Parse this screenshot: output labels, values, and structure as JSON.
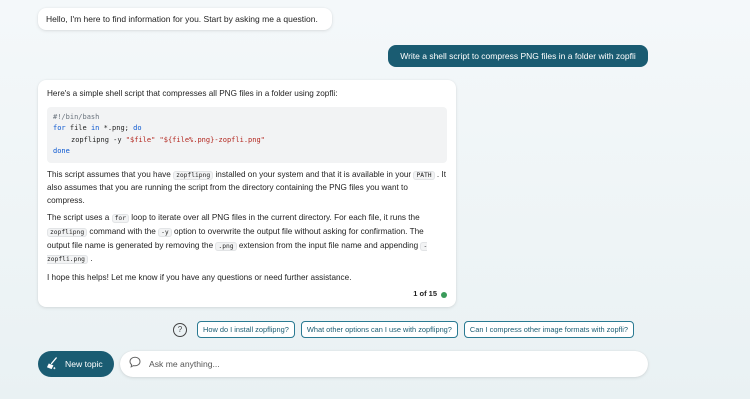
{
  "greeting": "Hello, I'm here to find information for you. Start by asking me a question.",
  "user_message": "Write a shell script to compress PNG files in a folder with zopfli",
  "answer": {
    "intro": "Here's a simple shell script that compresses all PNG files in a folder using zopfli:",
    "code": {
      "line1": "#!/bin/bash",
      "line2_kw1": "for",
      "line2_mid": " file ",
      "line2_kw2": "in",
      "line2_tail": " *.png; ",
      "line2_kw3": "do",
      "line3_cmd": "zopflipng -y ",
      "line3_str1": "\"$file\"",
      "line3_sp": " ",
      "line3_str2": "\"${file%.png}-zopfli.png\"",
      "line4": "done"
    },
    "p1_a": "This script assumes that you have ",
    "p1_code1": "zopflipng",
    "p1_b": " installed on your system and that it is available in your ",
    "p1_code2": "PATH",
    "p1_c": " . It also assumes that you are running the script from the directory containing the PNG files you want to compress.",
    "p2_a": "The script uses a ",
    "p2_code1": "for",
    "p2_b": " loop to iterate over all PNG files in the current directory. For each file, it runs the ",
    "p2_code2": "zopflipng",
    "p2_c": " command with the ",
    "p2_code3": "-y",
    "p2_d": " option to overwrite the output file without asking for confirmation. The output file name is generated by removing the ",
    "p2_code4": ".png",
    "p2_e": " extension from the input file name and appending ",
    "p2_code5": "-zopfli.png",
    "p2_f": " .",
    "p3": "I hope this helps! Let me know if you have any questions or need further assistance.",
    "counter": "1 of 15"
  },
  "suggestions": [
    "How do I install zopflipng?",
    "What other options can I use with zopflipng?",
    "Can I compress other image formats with zopfli?"
  ],
  "new_topic_label": "New topic",
  "input_placeholder": "Ask me anything...",
  "colors": {
    "accent": "#1a5c72",
    "status_dot": "#3a9b5a"
  },
  "icons": {
    "help": "help-circle-icon",
    "broom": "broom-icon",
    "chat": "chat-bubble-icon"
  }
}
